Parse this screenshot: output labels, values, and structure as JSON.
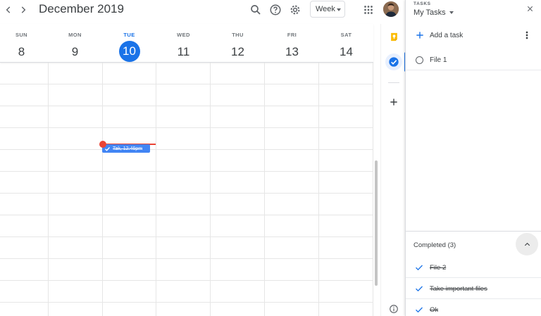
{
  "header": {
    "month_title": "December 2019",
    "view_label": "Week"
  },
  "days": [
    {
      "name": "SUN",
      "num": "8"
    },
    {
      "name": "MON",
      "num": "9"
    },
    {
      "name": "TUE",
      "num": "10"
    },
    {
      "name": "WED",
      "num": "11"
    },
    {
      "name": "THU",
      "num": "12"
    },
    {
      "name": "FRI",
      "num": "13"
    },
    {
      "name": "SAT",
      "num": "14"
    }
  ],
  "event": {
    "title": "Tak, 12:46pm"
  },
  "tasks": {
    "section_label": "TASKS",
    "list_name": "My Tasks",
    "add_label": "Add a task",
    "open": [
      {
        "title": "File 1"
      }
    ],
    "completed_header": "Completed (3)",
    "completed": [
      {
        "title": "File 2"
      },
      {
        "title": "Take important files"
      },
      {
        "title": "Ok"
      }
    ]
  },
  "colors": {
    "accent": "#1a73e8",
    "event": "#4285f4",
    "now_indicator": "#ea4335",
    "keep": "#fbbc04"
  },
  "icons": {
    "prev": "chevron-left-icon",
    "next": "chevron-right-icon",
    "search": "search-icon",
    "help": "help-icon",
    "settings": "gear-icon",
    "apps": "apps-grid-icon"
  }
}
